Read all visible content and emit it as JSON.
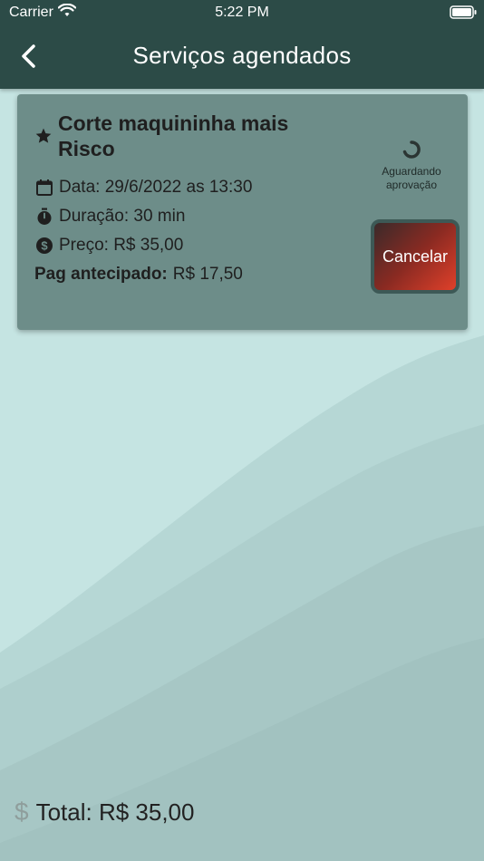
{
  "status_bar": {
    "carrier": "Carrier",
    "time": "5:22 PM"
  },
  "header": {
    "title": "Serviços agendados"
  },
  "service": {
    "name": "Corte maquininha mais Risco",
    "date_text": "Data: 29/6/2022 as 13:30",
    "duration_text": "Duração: 30 min",
    "price_text": "Preço: R$ 35,00",
    "advance_label": "Pag antecipado:",
    "advance_value": "R$ 17,50",
    "status": "Aguardando aprovação",
    "cancel_label": "Cancelar"
  },
  "total": {
    "symbol": "$",
    "text": "Total: R$ 35,00"
  },
  "colors": {
    "header": "#2c4b47",
    "card": "#6d8d89",
    "background": "#c3e2e0",
    "cancel_accent": "#e0402a"
  },
  "icons": [
    "back-icon",
    "star-icon",
    "calendar-icon",
    "stopwatch-icon",
    "dollar-circle-icon",
    "spinner-icon",
    "wifi-icon",
    "battery-icon",
    "dollar-icon"
  ]
}
